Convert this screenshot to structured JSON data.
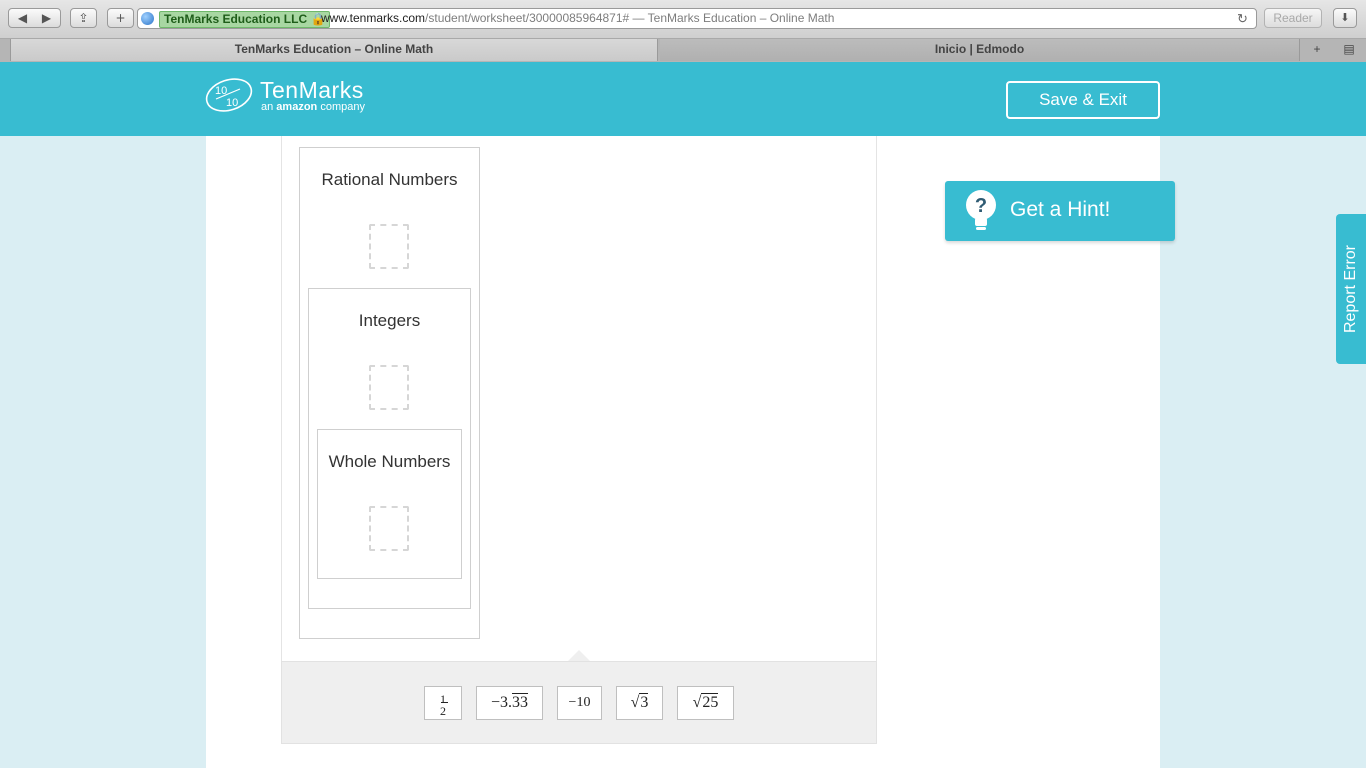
{
  "browser": {
    "ev_badge": "TenMarks Education LLC",
    "url_main": "www.tenmarks.com",
    "url_path": "/student/worksheet/30000085964871#",
    "url_title_suffix": " — TenMarks Education – Online Math",
    "reader_label": "Reader",
    "tabs": [
      "TenMarks Education – Online Math",
      "Inicio | Edmodo"
    ]
  },
  "header": {
    "logo_word": "TenMarks",
    "logo_tag_prefix": "an ",
    "logo_tag_brand": "amazon",
    "logo_tag_suffix": " company",
    "save_exit_label": "Save & Exit"
  },
  "sets": [
    {
      "title": "Rational Numbers"
    },
    {
      "title": "Integers"
    },
    {
      "title": "Whole Numbers"
    }
  ],
  "tiles": {
    "half_num": "1",
    "half_den": "2",
    "neg_repeating_whole": "−3.",
    "neg_repeating_digits": "33",
    "neg_ten": "−10",
    "sqrt_symbol": "√",
    "sqrt3_radicand": "3",
    "sqrt25_radicand": "25"
  },
  "hint_label": "Get a Hint!",
  "report_error_label": "Report Error",
  "colors": {
    "brand_teal": "#38bcd1",
    "page_bg": "#daeef3",
    "tray_bg": "#efefef"
  }
}
